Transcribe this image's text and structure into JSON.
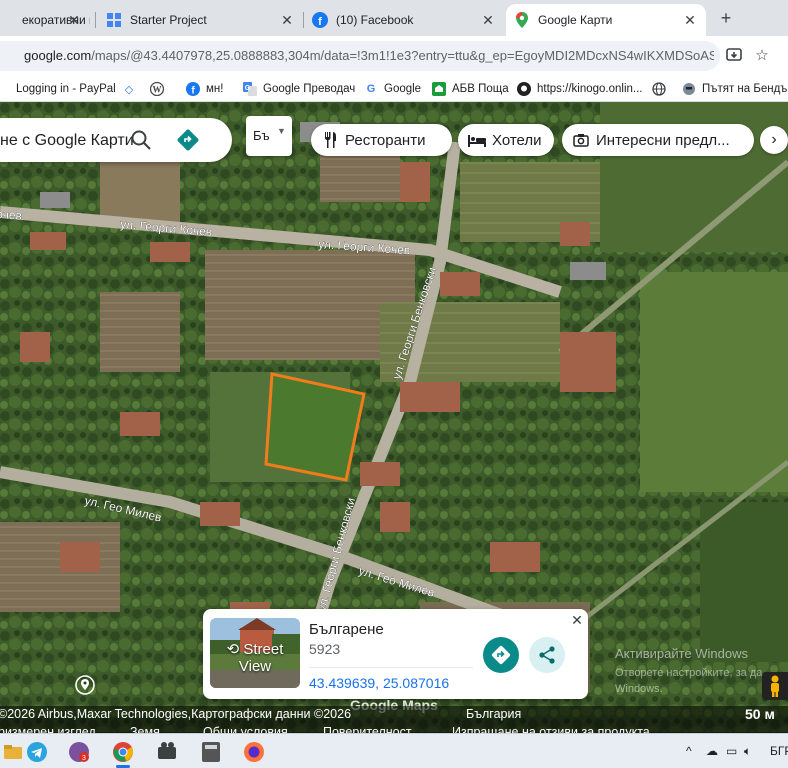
{
  "browser": {
    "tabs": [
      {
        "title": "екоративни и",
        "favicon": "shop-icon",
        "active": false
      },
      {
        "title": "Starter Project",
        "favicon": "grid-icon",
        "active": false
      },
      {
        "title": "(10) Facebook",
        "favicon": "facebook-icon",
        "active": false
      },
      {
        "title": "Google Карти",
        "favicon": "google-maps-icon",
        "active": true
      }
    ],
    "url_host": "google.com",
    "url_path": "/maps/@43.4407978,25.0888883,304m/data=!3m1!1e3?entry=ttu&g_ep=EgoyMDI2MDcxNS4wIKXMDSoASAFQ...",
    "bookmarks": [
      {
        "label": "Logging in - PayPal",
        "icon": "paypal-icon"
      },
      {
        "label": "",
        "icon": "diamond-icon"
      },
      {
        "label": "",
        "icon": "wordpress-icon"
      },
      {
        "label": "мн!",
        "icon": "facebook-icon"
      },
      {
        "label": "Google Преводач",
        "icon": "translate-icon"
      },
      {
        "label": "Google",
        "icon": "google-icon"
      },
      {
        "label": "АБВ Поща",
        "icon": "abv-icon"
      },
      {
        "label": "https://kinogo.onlin...",
        "icon": "github-icon"
      },
      {
        "label": "",
        "icon": "globe-icon"
      },
      {
        "label": "Пътят на Бендър",
        "icon": "bender-icon"
      }
    ]
  },
  "maps": {
    "search_placeholder": "не с Google Карти",
    "layer_lang": "Бъ",
    "chips": [
      {
        "label": "Ресторанти",
        "icon": "fork-knife-icon"
      },
      {
        "label": "Хотели",
        "icon": "bed-icon"
      },
      {
        "label": "Интересни предл...",
        "icon": "camera-icon"
      }
    ],
    "street_labels": [
      "ул. Георги Кочев",
      "ул. Георги Кочев",
      "ул. Георги Бенковски",
      "ул. Гео Милев",
      "ул. Гео Милев",
      "ул. Георги Бенковски",
      "очев"
    ],
    "card": {
      "street_view_label": "Street View",
      "place_name": "Българене",
      "postcode": "5923",
      "coordinates": "43.439639, 25.087016"
    },
    "watermark": {
      "line1": "Активирайте Windows",
      "line2": "Отворете настройките, за да",
      "line3": "Windows."
    },
    "logo": "Google Maps",
    "footer": {
      "attribution": "©2026 Airbus,Maxar Technologies,Картографски данни ©2026",
      "country": "България",
      "feedback": "Изпращане на отзиви за продукта",
      "scale": "50 м",
      "row2": [
        "ризмерен изглед",
        "Земя",
        "Общи условия",
        "Поверителност"
      ]
    }
  },
  "taskbar": {
    "apps": [
      "telegram-icon",
      "viber-icon",
      "chrome-icon",
      "media-icon",
      "calculator-icon",
      "firefox-icon"
    ],
    "tray_lang": "БГР"
  },
  "colors": {
    "parcel_outline": "#f07c1c",
    "accent": "#1a73e8",
    "directions": "#0b8a8a"
  }
}
